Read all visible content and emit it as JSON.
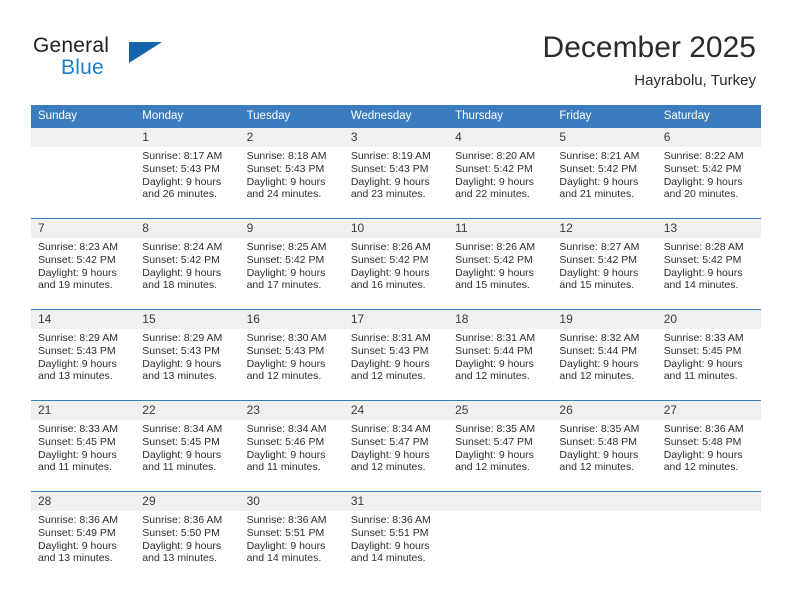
{
  "brand": {
    "name_part1": "General",
    "name_part2": "Blue",
    "flag_icon": "triangle-flag-icon"
  },
  "header": {
    "month_year": "December 2025",
    "location": "Hayrabolu, Turkey"
  },
  "theme": {
    "header_blue": "#3a7cbe",
    "brand_blue": "#1f7fc4",
    "flag_blue": "#1664ab",
    "daynum_band": "#f0f0f0",
    "text": "#2b2b2b"
  },
  "weekday_headers": [
    "Sunday",
    "Monday",
    "Tuesday",
    "Wednesday",
    "Thursday",
    "Friday",
    "Saturday"
  ],
  "weeks": [
    [
      {
        "day": "",
        "blank": true,
        "sunrise": "",
        "sunset": "",
        "daylight1": "",
        "daylight2": ""
      },
      {
        "day": "1",
        "sunrise": "Sunrise: 8:17 AM",
        "sunset": "Sunset: 5:43 PM",
        "daylight1": "Daylight: 9 hours",
        "daylight2": "and 26 minutes."
      },
      {
        "day": "2",
        "sunrise": "Sunrise: 8:18 AM",
        "sunset": "Sunset: 5:43 PM",
        "daylight1": "Daylight: 9 hours",
        "daylight2": "and 24 minutes."
      },
      {
        "day": "3",
        "sunrise": "Sunrise: 8:19 AM",
        "sunset": "Sunset: 5:43 PM",
        "daylight1": "Daylight: 9 hours",
        "daylight2": "and 23 minutes."
      },
      {
        "day": "4",
        "sunrise": "Sunrise: 8:20 AM",
        "sunset": "Sunset: 5:42 PM",
        "daylight1": "Daylight: 9 hours",
        "daylight2": "and 22 minutes."
      },
      {
        "day": "5",
        "sunrise": "Sunrise: 8:21 AM",
        "sunset": "Sunset: 5:42 PM",
        "daylight1": "Daylight: 9 hours",
        "daylight2": "and 21 minutes."
      },
      {
        "day": "6",
        "sunrise": "Sunrise: 8:22 AM",
        "sunset": "Sunset: 5:42 PM",
        "daylight1": "Daylight: 9 hours",
        "daylight2": "and 20 minutes."
      }
    ],
    [
      {
        "day": "7",
        "sunrise": "Sunrise: 8:23 AM",
        "sunset": "Sunset: 5:42 PM",
        "daylight1": "Daylight: 9 hours",
        "daylight2": "and 19 minutes."
      },
      {
        "day": "8",
        "sunrise": "Sunrise: 8:24 AM",
        "sunset": "Sunset: 5:42 PM",
        "daylight1": "Daylight: 9 hours",
        "daylight2": "and 18 minutes."
      },
      {
        "day": "9",
        "sunrise": "Sunrise: 8:25 AM",
        "sunset": "Sunset: 5:42 PM",
        "daylight1": "Daylight: 9 hours",
        "daylight2": "and 17 minutes."
      },
      {
        "day": "10",
        "sunrise": "Sunrise: 8:26 AM",
        "sunset": "Sunset: 5:42 PM",
        "daylight1": "Daylight: 9 hours",
        "daylight2": "and 16 minutes."
      },
      {
        "day": "11",
        "sunrise": "Sunrise: 8:26 AM",
        "sunset": "Sunset: 5:42 PM",
        "daylight1": "Daylight: 9 hours",
        "daylight2": "and 15 minutes."
      },
      {
        "day": "12",
        "sunrise": "Sunrise: 8:27 AM",
        "sunset": "Sunset: 5:42 PM",
        "daylight1": "Daylight: 9 hours",
        "daylight2": "and 15 minutes."
      },
      {
        "day": "13",
        "sunrise": "Sunrise: 8:28 AM",
        "sunset": "Sunset: 5:42 PM",
        "daylight1": "Daylight: 9 hours",
        "daylight2": "and 14 minutes."
      }
    ],
    [
      {
        "day": "14",
        "sunrise": "Sunrise: 8:29 AM",
        "sunset": "Sunset: 5:43 PM",
        "daylight1": "Daylight: 9 hours",
        "daylight2": "and 13 minutes."
      },
      {
        "day": "15",
        "sunrise": "Sunrise: 8:29 AM",
        "sunset": "Sunset: 5:43 PM",
        "daylight1": "Daylight: 9 hours",
        "daylight2": "and 13 minutes."
      },
      {
        "day": "16",
        "sunrise": "Sunrise: 8:30 AM",
        "sunset": "Sunset: 5:43 PM",
        "daylight1": "Daylight: 9 hours",
        "daylight2": "and 12 minutes."
      },
      {
        "day": "17",
        "sunrise": "Sunrise: 8:31 AM",
        "sunset": "Sunset: 5:43 PM",
        "daylight1": "Daylight: 9 hours",
        "daylight2": "and 12 minutes."
      },
      {
        "day": "18",
        "sunrise": "Sunrise: 8:31 AM",
        "sunset": "Sunset: 5:44 PM",
        "daylight1": "Daylight: 9 hours",
        "daylight2": "and 12 minutes."
      },
      {
        "day": "19",
        "sunrise": "Sunrise: 8:32 AM",
        "sunset": "Sunset: 5:44 PM",
        "daylight1": "Daylight: 9 hours",
        "daylight2": "and 12 minutes."
      },
      {
        "day": "20",
        "sunrise": "Sunrise: 8:33 AM",
        "sunset": "Sunset: 5:45 PM",
        "daylight1": "Daylight: 9 hours",
        "daylight2": "and 11 minutes."
      }
    ],
    [
      {
        "day": "21",
        "sunrise": "Sunrise: 8:33 AM",
        "sunset": "Sunset: 5:45 PM",
        "daylight1": "Daylight: 9 hours",
        "daylight2": "and 11 minutes."
      },
      {
        "day": "22",
        "sunrise": "Sunrise: 8:34 AM",
        "sunset": "Sunset: 5:45 PM",
        "daylight1": "Daylight: 9 hours",
        "daylight2": "and 11 minutes."
      },
      {
        "day": "23",
        "sunrise": "Sunrise: 8:34 AM",
        "sunset": "Sunset: 5:46 PM",
        "daylight1": "Daylight: 9 hours",
        "daylight2": "and 11 minutes."
      },
      {
        "day": "24",
        "sunrise": "Sunrise: 8:34 AM",
        "sunset": "Sunset: 5:47 PM",
        "daylight1": "Daylight: 9 hours",
        "daylight2": "and 12 minutes."
      },
      {
        "day": "25",
        "sunrise": "Sunrise: 8:35 AM",
        "sunset": "Sunset: 5:47 PM",
        "daylight1": "Daylight: 9 hours",
        "daylight2": "and 12 minutes."
      },
      {
        "day": "26",
        "sunrise": "Sunrise: 8:35 AM",
        "sunset": "Sunset: 5:48 PM",
        "daylight1": "Daylight: 9 hours",
        "daylight2": "and 12 minutes."
      },
      {
        "day": "27",
        "sunrise": "Sunrise: 8:36 AM",
        "sunset": "Sunset: 5:48 PM",
        "daylight1": "Daylight: 9 hours",
        "daylight2": "and 12 minutes."
      }
    ],
    [
      {
        "day": "28",
        "sunrise": "Sunrise: 8:36 AM",
        "sunset": "Sunset: 5:49 PM",
        "daylight1": "Daylight: 9 hours",
        "daylight2": "and 13 minutes."
      },
      {
        "day": "29",
        "sunrise": "Sunrise: 8:36 AM",
        "sunset": "Sunset: 5:50 PM",
        "daylight1": "Daylight: 9 hours",
        "daylight2": "and 13 minutes."
      },
      {
        "day": "30",
        "sunrise": "Sunrise: 8:36 AM",
        "sunset": "Sunset: 5:51 PM",
        "daylight1": "Daylight: 9 hours",
        "daylight2": "and 14 minutes."
      },
      {
        "day": "31",
        "sunrise": "Sunrise: 8:36 AM",
        "sunset": "Sunset: 5:51 PM",
        "daylight1": "Daylight: 9 hours",
        "daylight2": "and 14 minutes."
      },
      {
        "day": "",
        "blank": true,
        "sunrise": "",
        "sunset": "",
        "daylight1": "",
        "daylight2": ""
      },
      {
        "day": "",
        "blank": true,
        "sunrise": "",
        "sunset": "",
        "daylight1": "",
        "daylight2": ""
      },
      {
        "day": "",
        "blank": true,
        "sunrise": "",
        "sunset": "",
        "daylight1": "",
        "daylight2": ""
      }
    ]
  ]
}
